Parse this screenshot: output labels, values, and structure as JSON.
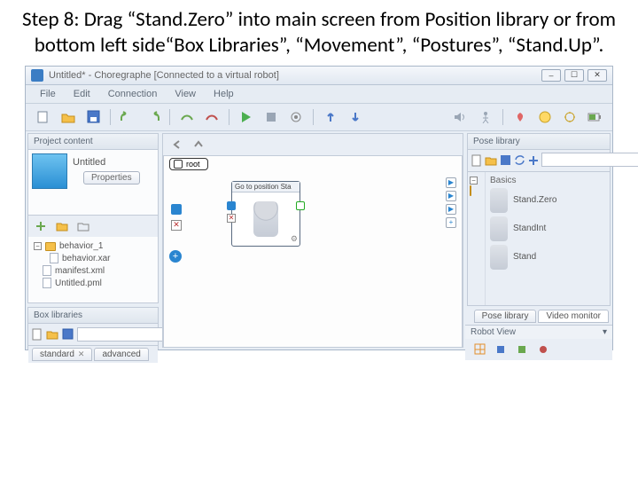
{
  "slide": {
    "title": "Step 8: Drag “Stand.Zero” into main screen from Position library or from bottom left side“Box Libraries”, “Movement”, “Postures”, “Stand.Up”."
  },
  "window": {
    "title": "Untitled* - Choregraphe [Connected to a virtual robot]",
    "controls": {
      "min": "–",
      "max": "☐",
      "close": "✕"
    }
  },
  "menu": [
    "File",
    "Edit",
    "Connection",
    "View",
    "Help"
  ],
  "panels": {
    "project": {
      "header": "Project content",
      "title": "Untitled",
      "properties_btn": "Properties",
      "tree": {
        "root": "behavior_1",
        "items": [
          "behavior.xar",
          "manifest.xml",
          "Untitled.pml"
        ]
      }
    },
    "boxlib": {
      "header": "Box libraries",
      "tabs": [
        "standard",
        "advanced"
      ]
    },
    "diagram": {
      "breadcrumb": "root",
      "node_title": "Go to position Sta"
    },
    "poselib": {
      "header": "Pose library",
      "group": "Basics",
      "items": [
        "Stand.Zero",
        "StandInt",
        "Stand"
      ]
    },
    "right_tabs": [
      "Pose library",
      "Video monitor"
    ],
    "robot_view": {
      "header": "Robot View"
    }
  }
}
